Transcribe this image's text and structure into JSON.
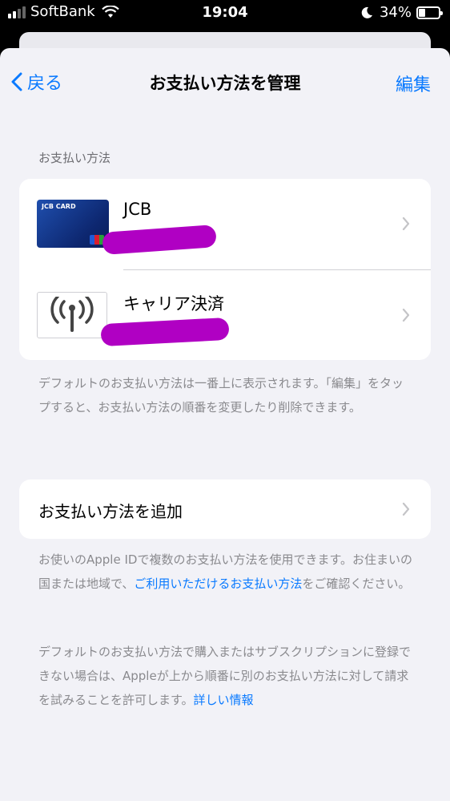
{
  "status_bar": {
    "carrier": "SoftBank",
    "time": "19:04",
    "battery": "34%",
    "battery_level": 0.34
  },
  "nav": {
    "back_label": "戻る",
    "title": "お支払い方法を管理",
    "edit_label": "編集"
  },
  "payment_section": {
    "header": "お支払い方法",
    "items": [
      {
        "title": "JCB",
        "card_brand_text": "JCB CARD"
      },
      {
        "title": "キャリア決済"
      }
    ],
    "footnote": "デフォルトのお支払い方法は一番上に表示されます。「編集」をタップすると、お支払い方法の順番を変更したり削除できます。"
  },
  "add_payment": {
    "label": "お支払い方法を追加"
  },
  "info": {
    "para1_before_link": "お使いのApple IDで複数のお支払い方法を使用できます。お住まいの国または地域で、",
    "para1_link": "ご利用いただけるお支払い方法",
    "para1_after_link": "をご確認ください。",
    "para2_text": "デフォルトのお支払い方法で購入またはサブスクリプションに登録できない場合は、Appleが上から順番に別のお支払い方法に対して請求を試みることを許可します。",
    "para2_link": "詳しい情報"
  },
  "colors": {
    "accent": "#0a7aff",
    "redaction": "#b000c3",
    "background": "#f2f2f7"
  }
}
